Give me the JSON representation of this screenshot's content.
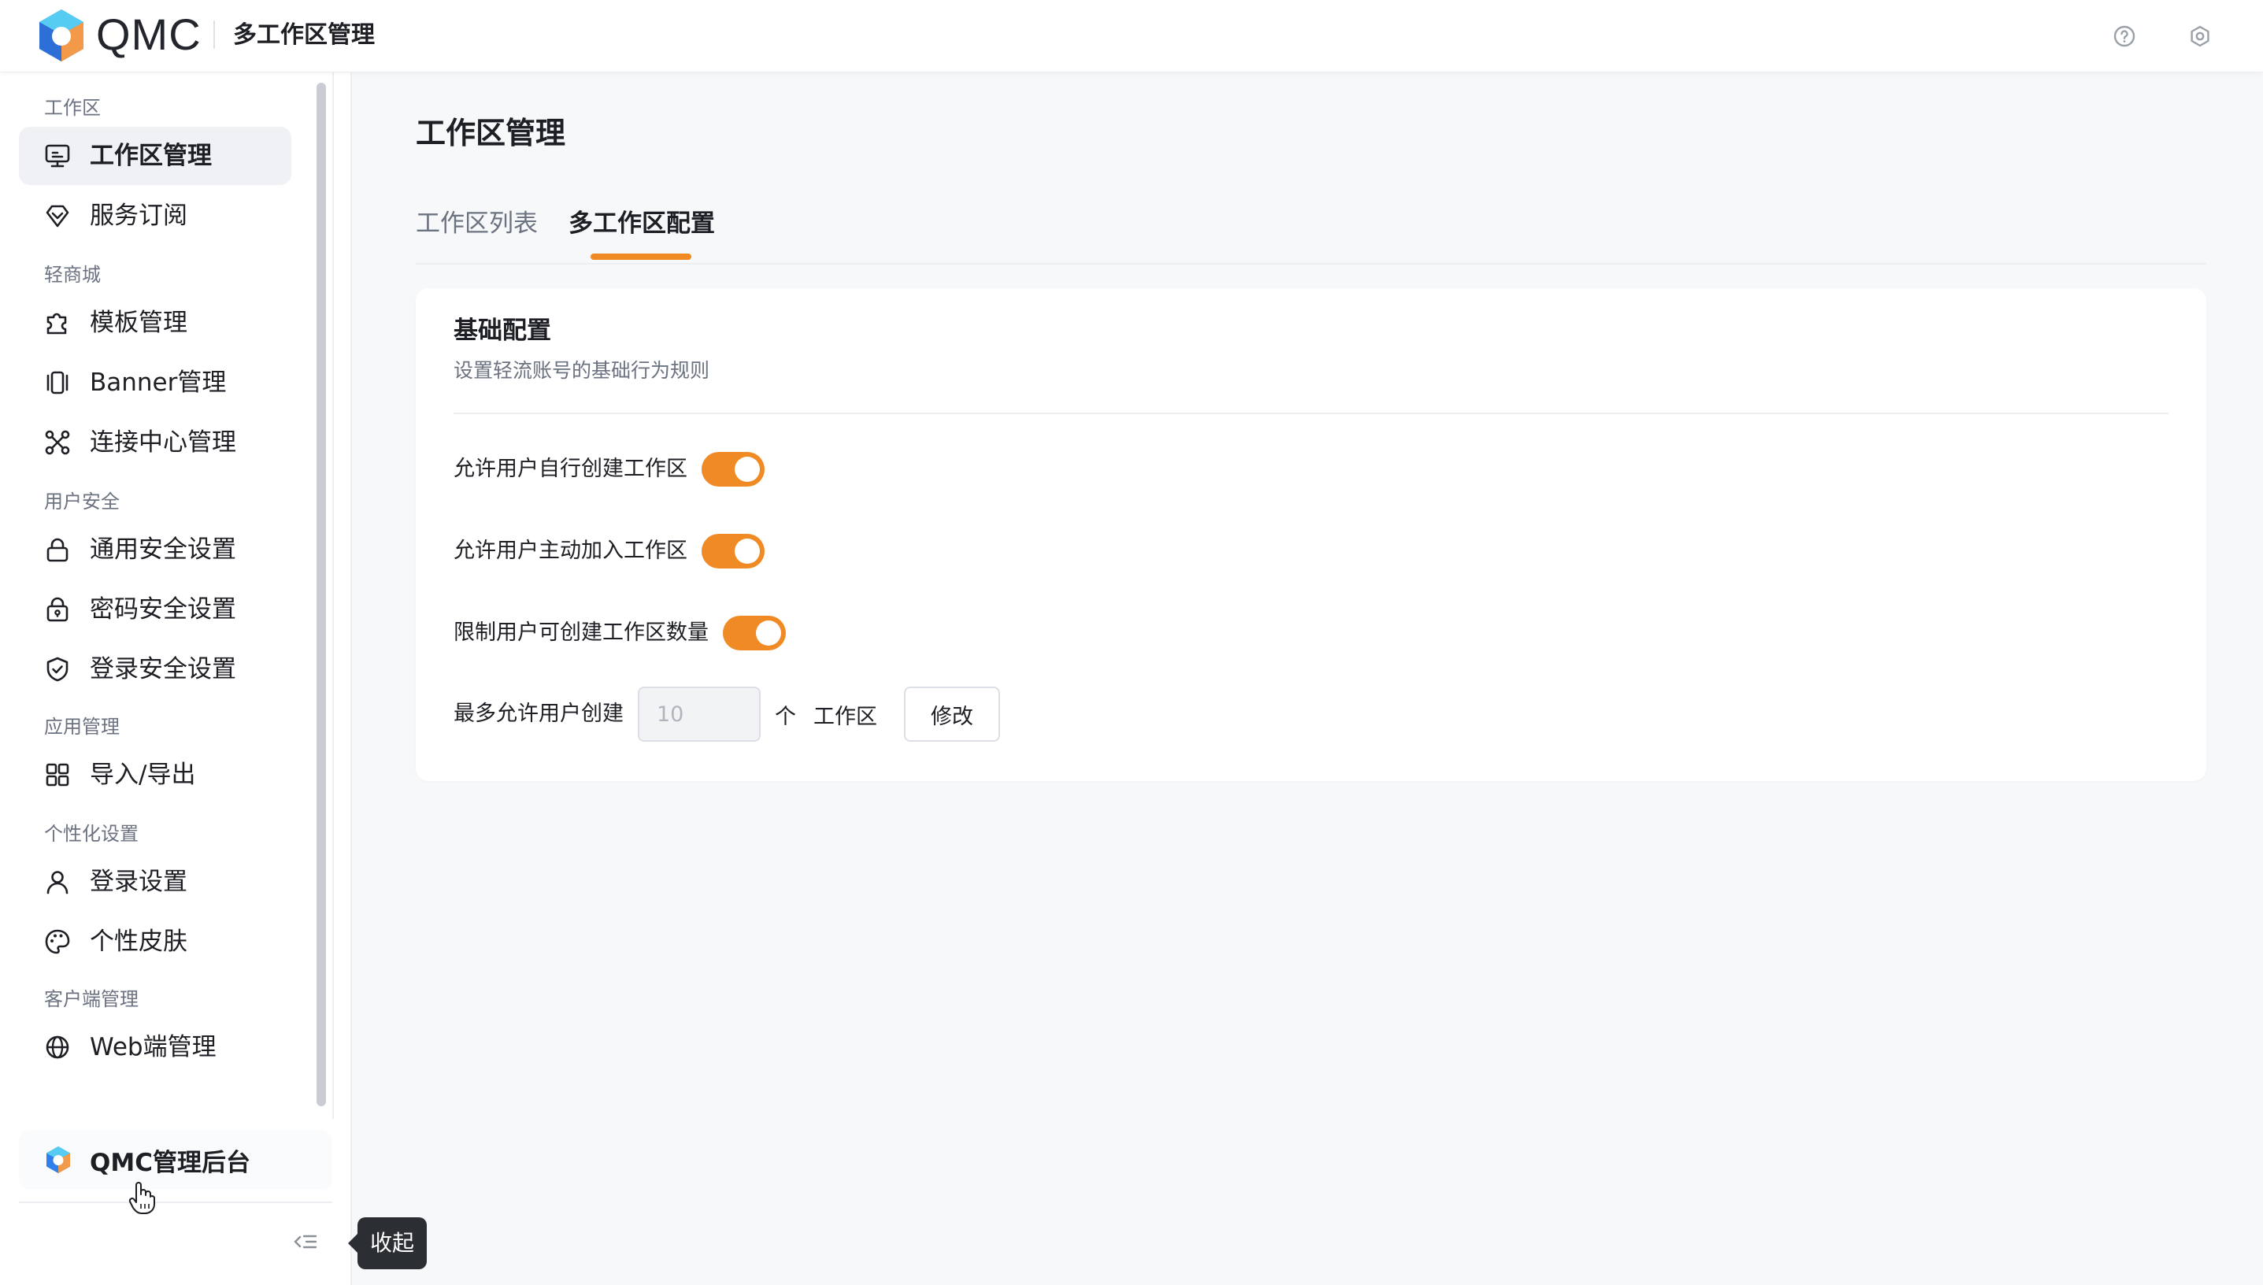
{
  "header": {
    "brand": "QMC",
    "title": "多工作区管理"
  },
  "sidebar": {
    "groups": [
      {
        "title": "工作区"
      },
      {
        "title": "轻商城"
      },
      {
        "title": "用户安全"
      },
      {
        "title": "应用管理"
      },
      {
        "title": "个性化设置"
      },
      {
        "title": "客户端管理"
      }
    ],
    "items": [
      {
        "label": "工作区管理"
      },
      {
        "label": "服务订阅"
      },
      {
        "label": "模板管理"
      },
      {
        "label": "Banner管理"
      },
      {
        "label": "连接中心管理"
      },
      {
        "label": "通用安全设置"
      },
      {
        "label": "密码安全设置"
      },
      {
        "label": "登录安全设置"
      },
      {
        "label": "导入/导出"
      },
      {
        "label": "登录设置"
      },
      {
        "label": "个性皮肤"
      },
      {
        "label": "Web端管理"
      }
    ],
    "bottom_label": "QMC管理后台",
    "collapse_tooltip": "收起"
  },
  "main": {
    "page_title": "工作区管理",
    "tabs": [
      {
        "label": "工作区列表"
      },
      {
        "label": "多工作区配置"
      }
    ],
    "card": {
      "title": "基础配置",
      "subtitle": "设置轻流账号的基础行为规则",
      "toggles": [
        {
          "label": "允许用户自行创建工作区",
          "on": true
        },
        {
          "label": "允许用户主动加入工作区",
          "on": true
        },
        {
          "label": "限制用户可创建工作区数量",
          "on": true
        }
      ],
      "limit": {
        "label": "最多允许用户创建",
        "value": "10",
        "unit_count": "个",
        "unit_name": "工作区",
        "edit_label": "修改"
      }
    }
  },
  "colors": {
    "accent": "#f08a24",
    "logo_blue": "#3b82f6"
  }
}
